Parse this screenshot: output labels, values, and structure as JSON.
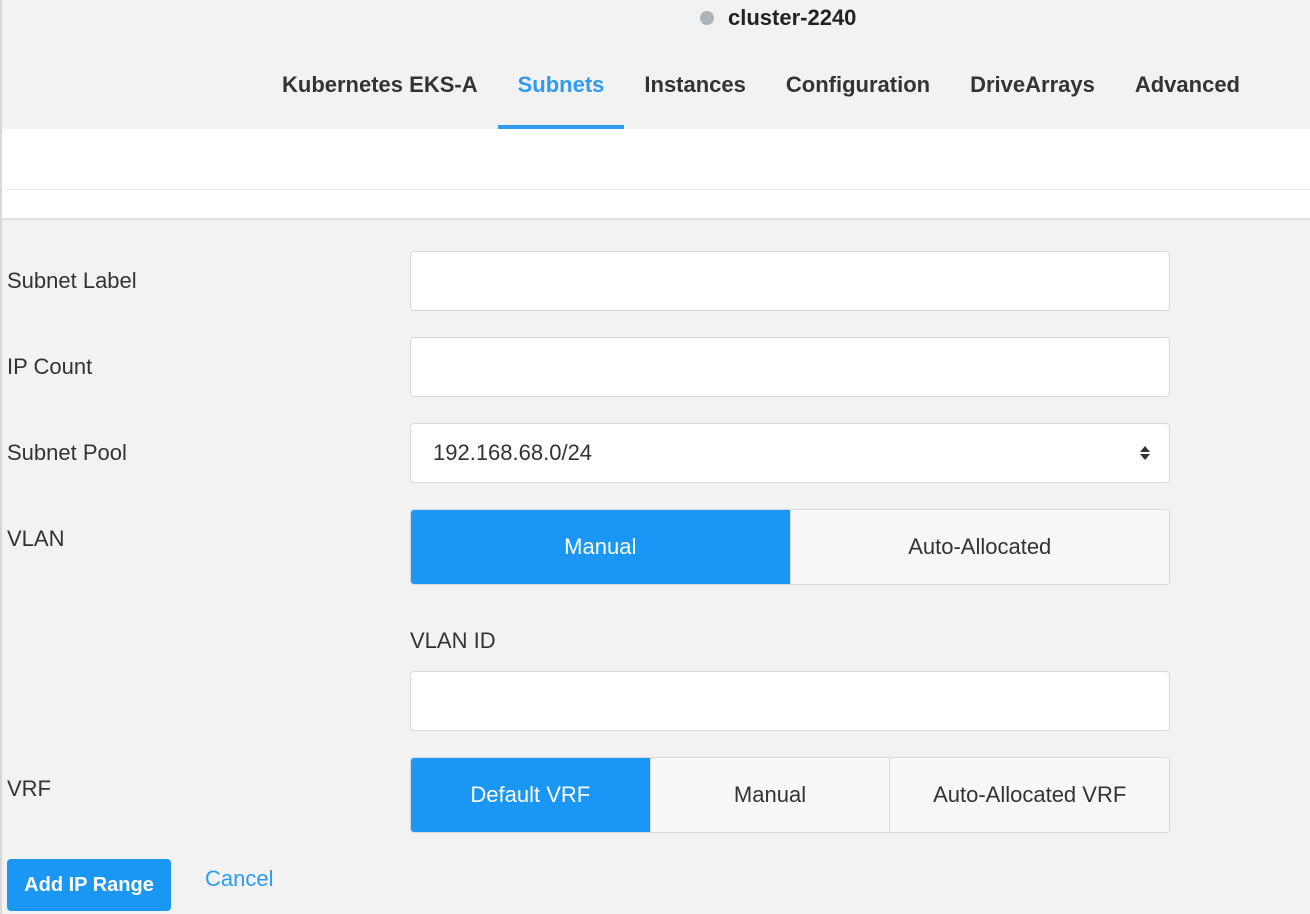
{
  "cluster": {
    "name": "cluster-2240",
    "status_color": "#aeb3b8"
  },
  "tabs": [
    {
      "label": "Kubernetes EKS-A",
      "active": false
    },
    {
      "label": "Subnets",
      "active": true
    },
    {
      "label": "Instances",
      "active": false
    },
    {
      "label": "Configuration",
      "active": false
    },
    {
      "label": "DriveArrays",
      "active": false
    },
    {
      "label": "Advanced",
      "active": false
    }
  ],
  "form": {
    "subnet_label": {
      "label": "Subnet Label",
      "value": ""
    },
    "ip_count": {
      "label": "IP Count",
      "value": ""
    },
    "subnet_pool": {
      "label": "Subnet Pool",
      "value": "192.168.68.0/24"
    },
    "vlan": {
      "label": "VLAN",
      "options": [
        "Manual",
        "Auto-Allocated"
      ],
      "selected": "Manual"
    },
    "vlan_id": {
      "label": "VLAN ID",
      "value": ""
    },
    "vrf": {
      "label": "VRF",
      "options": [
        "Default VRF",
        "Manual",
        "Auto-Allocated VRF"
      ],
      "selected": "Default VRF"
    }
  },
  "actions": {
    "add_label": "Add IP Range",
    "cancel_label": "Cancel"
  },
  "colors": {
    "accent": "#1a97f5",
    "link": "#2e9bf0",
    "background": "#f2f2f2"
  }
}
